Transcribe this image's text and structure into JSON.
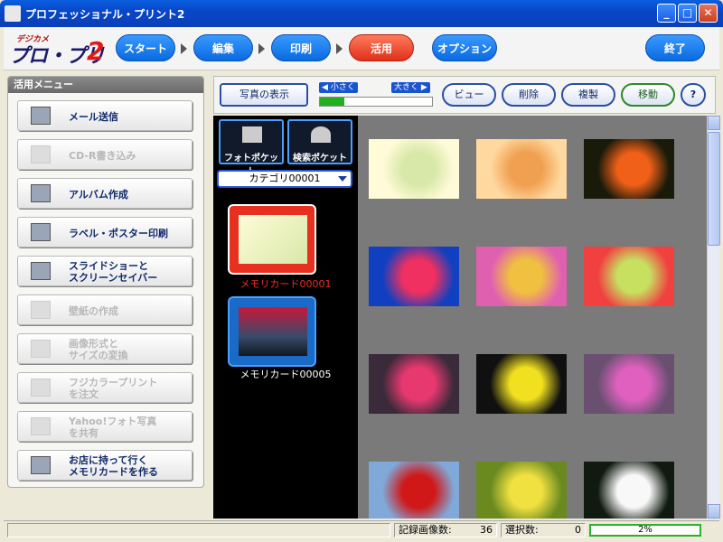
{
  "window": {
    "title": "プロフェッショナル・プリント2",
    "min": "_",
    "max": "□",
    "close": "✕"
  },
  "logo": {
    "small": "デジカメ",
    "big": "プロ・プリ",
    "two": "2"
  },
  "nav": {
    "start": "スタート",
    "edit": "編集",
    "print": "印刷",
    "use": "活用",
    "option": "オプション",
    "exit": "終了"
  },
  "left_menu": {
    "header": "活用メニュー",
    "items": [
      {
        "label": "メール送信",
        "enabled": true
      },
      {
        "label": "CD-R書き込み",
        "enabled": false
      },
      {
        "label": "アルバム作成",
        "enabled": true
      },
      {
        "label": "ラベル・ポスター印刷",
        "enabled": true
      },
      {
        "label": "スライドショーと\nスクリーンセイバー",
        "enabled": true
      },
      {
        "label": "壁紙の作成",
        "enabled": false
      },
      {
        "label": "画像形式と\nサイズの変換",
        "enabled": false
      },
      {
        "label": "フジカラープリント\nを注文",
        "enabled": false
      },
      {
        "label": "Yahoo!フォト写真\nを共有",
        "enabled": false
      },
      {
        "label": "お店に持って行く\nメモリカードを作る",
        "enabled": true
      }
    ]
  },
  "toolbar": {
    "display": "写真の表示",
    "smaller": "◀ 小さく",
    "larger": "大きく ▶",
    "view": "ビュー",
    "delete": "削除",
    "copy": "複製",
    "move": "移動",
    "help": "?",
    "zoom_fraction": 0.22
  },
  "pockets": {
    "photo": "フォトポケット",
    "search": "検索ポケット",
    "category": "カテゴリ00001",
    "cards": [
      {
        "label": "メモリカード00001",
        "selected": true
      },
      {
        "label": "メモリカード00005",
        "selected": false
      }
    ]
  },
  "thumbnails": [
    {
      "colors": [
        "#fffbd8",
        "#d8e8a8"
      ]
    },
    {
      "colors": [
        "#ffd9a0",
        "#f0a050"
      ]
    },
    {
      "colors": [
        "#1a1a0a",
        "#f06018"
      ]
    },
    {
      "colors": [
        "#1040c0",
        "#f03060"
      ]
    },
    {
      "colors": [
        "#e060b0",
        "#f0c040"
      ]
    },
    {
      "colors": [
        "#f04040",
        "#c8e060"
      ]
    },
    {
      "colors": [
        "#3a2a3a",
        "#e83870"
      ]
    },
    {
      "colors": [
        "#101010",
        "#f0e020"
      ]
    },
    {
      "colors": [
        "#6a5070",
        "#e060c0"
      ]
    },
    {
      "colors": [
        "#80a8d8",
        "#d01818"
      ]
    },
    {
      "colors": [
        "#6a8a20",
        "#f0e040"
      ]
    },
    {
      "colors": [
        "#101a10",
        "#f8f8f8"
      ]
    }
  ],
  "status": {
    "recorded_label": "記録画像数:",
    "recorded_count": "36",
    "selected_label": "選択数:",
    "selected_count": "0",
    "progress": "2%"
  }
}
